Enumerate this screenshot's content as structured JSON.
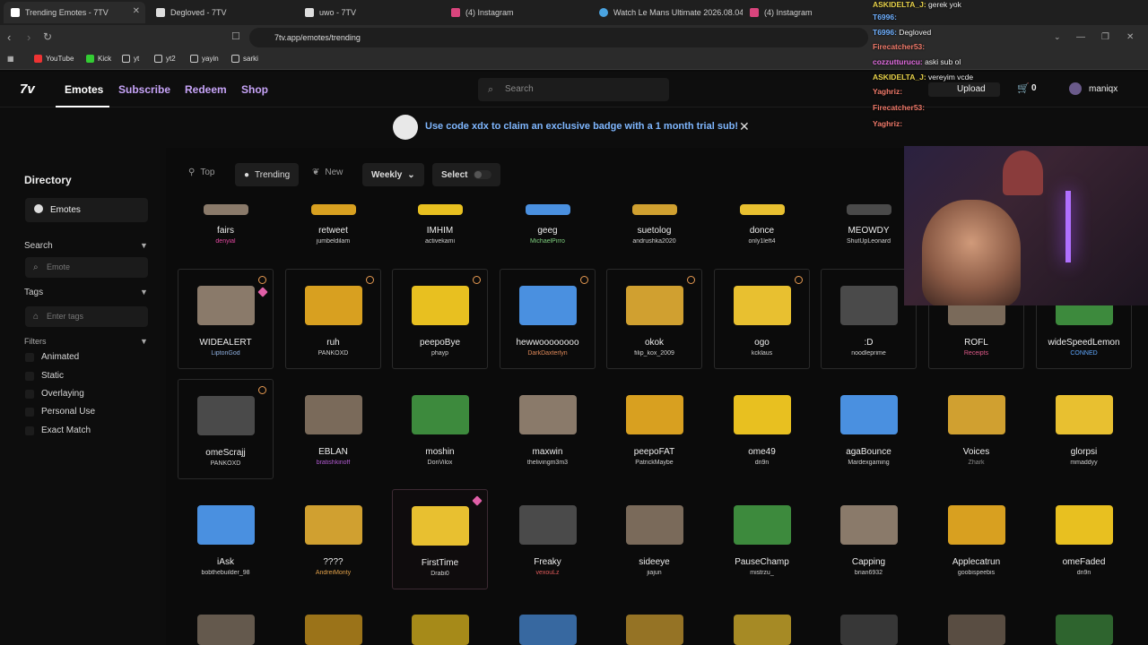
{
  "browser": {
    "tabs": [
      {
        "title": "Trending Emotes - 7TV",
        "active": true
      },
      {
        "title": "Degloved - 7TV"
      },
      {
        "title": "uwo - 7TV"
      },
      {
        "title": "(4) Instagram"
      },
      {
        "title": "Watch Le Mans Ultimate 2026.08.04"
      },
      {
        "title": "(4) Instagram"
      }
    ],
    "url": "7tv.app/emotes/trending",
    "bookmarks": [
      "YouTube",
      "Kick",
      "yt",
      "yt2",
      "yayin",
      "sarki"
    ]
  },
  "header": {
    "logo": "7v",
    "nav": [
      "Emotes",
      "Subscribe",
      "Redeem",
      "Shop"
    ],
    "search_placeholder": "Search",
    "upload_label": "Upload",
    "cart_count": "0",
    "username": "maniqx"
  },
  "banner": {
    "text": "Use code xdx to claim an exclusive badge with a 1 month trial sub!"
  },
  "sidebar": {
    "title": "Directory",
    "emotes_item": "Emotes",
    "search_label": "Search",
    "search_placeholder": "Emote",
    "tags_label": "Tags",
    "tags_placeholder": "Enter tags",
    "filters_label": "Filters",
    "filters": [
      "Animated",
      "Static",
      "Overlaying",
      "Personal Use",
      "Exact Match"
    ]
  },
  "toolbar": {
    "top": "Top",
    "trending": "Trending",
    "new": "New",
    "period": "Weekly",
    "select": "Select"
  },
  "emotes": {
    "row0": [
      {
        "name": "fairs",
        "owner": "denyial",
        "oc": "#e0479e"
      },
      {
        "name": "retweet",
        "owner": "jumbeldilam",
        "oc": "#cfcfcf"
      },
      {
        "name": "IMHIM",
        "owner": "activekami",
        "oc": "#cfcfcf"
      },
      {
        "name": "geeg",
        "owner": "MichaelPirro",
        "oc": "#7fd07f"
      },
      {
        "name": "suetolog",
        "owner": "andrushka2020",
        "oc": "#cfcfcf"
      },
      {
        "name": "donce",
        "owner": "only1left4",
        "oc": "#cfcfcf"
      },
      {
        "name": "MEOWDY",
        "owner": "ShutUpLeonard",
        "oc": "#cfcfcf"
      }
    ],
    "row1": [
      {
        "name": "WIDEALERT",
        "owner": "LiptonGod",
        "oc": "#8fb0e0"
      },
      {
        "name": "ruh",
        "owner": "PANKOXD",
        "oc": "#cfcfcf"
      },
      {
        "name": "peepoBye",
        "owner": "phayp",
        "oc": "#cfcfcf"
      },
      {
        "name": "hewwoooooooo",
        "owner": "DarkDaxterlyn",
        "oc": "#e08a5a"
      },
      {
        "name": "okok",
        "owner": "filip_kox_2009",
        "oc": "#cfcfcf"
      },
      {
        "name": "ogo",
        "owner": "kcklaus",
        "oc": "#cfcfcf"
      },
      {
        "name": ":D",
        "owner": "noodleprime",
        "oc": "#cfcfcf"
      },
      {
        "name": "ROFL",
        "owner": "Receipts",
        "oc": "#e05a8a"
      },
      {
        "name": "wideSpeedLemon",
        "owner": "CONNED",
        "oc": "#5fa8ff"
      }
    ],
    "row2": [
      {
        "name": "omeScrajj",
        "owner": "PANKOXD",
        "oc": "#cfcfcf"
      },
      {
        "name": "EBLAN",
        "owner": "bratishkinoff",
        "oc": "#b05ad0"
      },
      {
        "name": "moshin",
        "owner": "DonVilox",
        "oc": "#cfcfcf"
      },
      {
        "name": "maxwin",
        "owner": "thelivingm3m3",
        "oc": "#cfcfcf"
      },
      {
        "name": "peepoFAT",
        "owner": "PatrickMaybe",
        "oc": "#cfcfcf"
      },
      {
        "name": "ome49",
        "owner": "dn9n",
        "oc": "#cfcfcf"
      },
      {
        "name": "agaBounce",
        "owner": "Mardexgaming",
        "oc": "#cfcfcf"
      },
      {
        "name": "Voices",
        "owner": "Zhark",
        "oc": "#8a8a8a"
      },
      {
        "name": "glorpsi",
        "owner": "mmaddyy",
        "oc": "#cfcfcf"
      }
    ],
    "row3": [
      {
        "name": "iAsk",
        "owner": "bobthebuilder_98",
        "oc": "#cfcfcf"
      },
      {
        "name": "????",
        "owner": "AndreiMonty",
        "oc": "#e0a04a"
      },
      {
        "name": "FirstTime",
        "owner": "Drabi0",
        "oc": "#cfcfcf"
      },
      {
        "name": "Freaky",
        "owner": "vexouLz",
        "oc": "#e05a5a"
      },
      {
        "name": "sideeye",
        "owner": "jiajun",
        "oc": "#cfcfcf"
      },
      {
        "name": "PauseChamp",
        "owner": "mistrzu_",
        "oc": "#cfcfcf"
      },
      {
        "name": "Capping",
        "owner": "brian6932",
        "oc": "#cfcfcf"
      },
      {
        "name": "Applecatrun",
        "owner": "goobispeebis",
        "oc": "#cfcfcf"
      },
      {
        "name": "omeFaded",
        "owner": "dn9n",
        "oc": "#cfcfcf"
      }
    ]
  },
  "chat": [
    {
      "user": "ASKIDELTA_J",
      "msg": "gerek yok",
      "uc": "u1"
    },
    {
      "user": "T6996",
      "msg": "",
      "uc": "u2"
    },
    {
      "user": "T6996",
      "msg": "Degloved",
      "uc": "u2"
    },
    {
      "user": "Firecatcher53",
      "msg": "",
      "uc": "u3"
    },
    {
      "user": "cozzutturucu",
      "msg": "aski sub ol",
      "uc": "u4"
    },
    {
      "user": "ASKIDELTA_J",
      "msg": "vereyim vcde",
      "uc": "u1"
    },
    {
      "user": "Yaghriz",
      "msg": "",
      "uc": "u3"
    },
    {
      "user": "Firecatcher53",
      "msg": "",
      "uc": "u3"
    },
    {
      "user": "Yaghriz",
      "msg": "",
      "uc": "u3"
    }
  ],
  "colors": {
    "accent": "#c7a4f8",
    "banner_text": "#7fb7ff",
    "bg": "#0b0b0b"
  }
}
